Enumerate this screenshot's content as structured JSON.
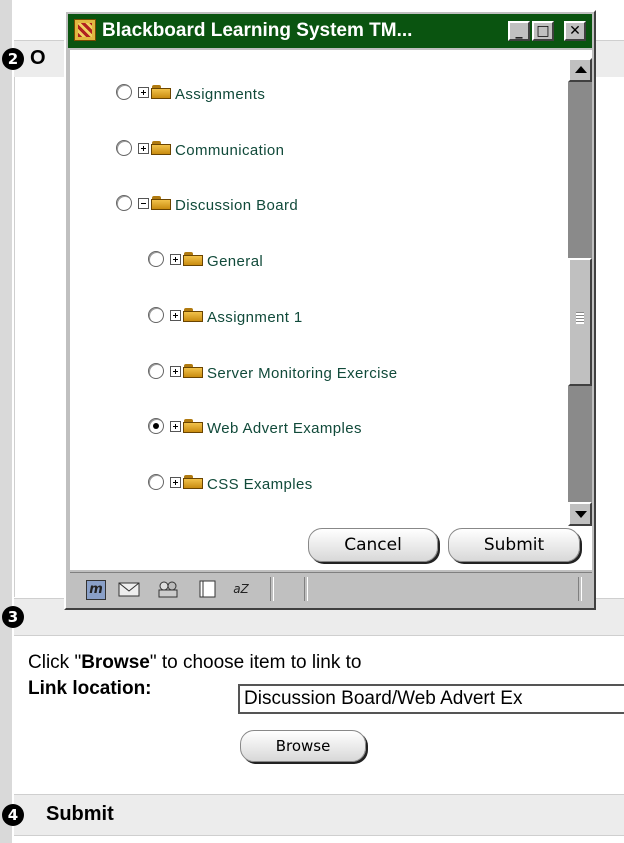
{
  "popup": {
    "title": "Blackboard Learning System TM...",
    "window_controls": {
      "minimize": "_",
      "maximize": "□",
      "close": "✕"
    },
    "tree_items": [
      {
        "label": "Assignments",
        "level": 0,
        "expander": "plus",
        "selected": false
      },
      {
        "label": "Communication",
        "level": 0,
        "expander": "plus",
        "selected": false
      },
      {
        "label": "Discussion Board",
        "level": 0,
        "expander": "minus",
        "selected": false
      },
      {
        "label": "General",
        "level": 1,
        "expander": "plus",
        "selected": false
      },
      {
        "label": "Assignment 1",
        "level": 1,
        "expander": "plus",
        "selected": false
      },
      {
        "label": "Server Monitoring Exercise",
        "level": 1,
        "expander": "plus",
        "selected": false
      },
      {
        "label": "Web Advert Examples",
        "level": 1,
        "expander": "plus",
        "selected": true
      },
      {
        "label": "CSS Examples",
        "level": 1,
        "expander": "plus",
        "selected": false
      }
    ],
    "cancel_label": "Cancel",
    "submit_label": "Submit",
    "status_icons": [
      "m-icon",
      "mail-icon",
      "people-icon",
      "composer-icon",
      "az-icon"
    ],
    "status_glyphs": {
      "m": "m",
      "az": "aZ"
    }
  },
  "page": {
    "step2": {
      "number": "2",
      "title_partial": "O"
    },
    "step3": {
      "number": "3",
      "instruction_prefix": "Click \"",
      "instruction_bold": "Browse",
      "instruction_suffix": "\" to choose item to link to",
      "link_label": "Link location:",
      "link_value": "Discussion Board/Web Advert Ex",
      "browse_label": "Browse"
    },
    "step4": {
      "number": "4",
      "title": "Submit"
    }
  },
  "colors": {
    "titlebar": "#0a5410",
    "tree_text": "#114a3a",
    "window_face": "#c0c0c0"
  }
}
